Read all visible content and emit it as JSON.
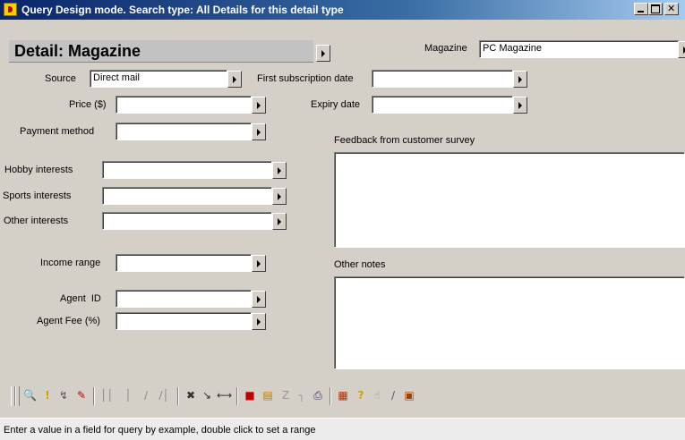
{
  "window": {
    "title": "Query Design mode. Search type: All Details for this detail type"
  },
  "header": {
    "detail_title": "Detail: Magazine"
  },
  "magazine": {
    "label": "Magazine",
    "value": "PC Magazine"
  },
  "fields": {
    "source": {
      "label": "Source",
      "value": "Direct mail"
    },
    "price": {
      "label": "Price ($)",
      "value": ""
    },
    "payment_method": {
      "label": "Payment method",
      "value": ""
    },
    "first_subscription_date": {
      "label": "First subscription date",
      "value": ""
    },
    "expiry_date": {
      "label": "Expiry date",
      "value": ""
    },
    "hobby_interests": {
      "label": "Hobby interests",
      "value": ""
    },
    "sports_interests": {
      "label": "Sports interests",
      "value": ""
    },
    "other_interests": {
      "label": "Other interests",
      "value": ""
    },
    "income_range": {
      "label": "Income range",
      "value": ""
    },
    "agent_id": {
      "label": "Agent  ID",
      "value": ""
    },
    "agent_fee": {
      "label": "Agent Fee (%)",
      "value": ""
    }
  },
  "feedback": {
    "label": "Feedback from customer survey"
  },
  "other_notes": {
    "label": "Other notes"
  },
  "toolbar": {
    "icons": [
      "magnify-icon",
      "exclamation-icon",
      "wand-icon",
      "pencil-icon",
      "bar-icon",
      "line-icon",
      "slash-icon",
      "slash2-icon",
      "cross-icon",
      "arrow-icon",
      "double-arrow-icon",
      "book-icon",
      "clipboard-icon",
      "z-icon",
      "frame-icon",
      "search-doc-icon",
      "chart-icon",
      "help-icon",
      "hand-icon",
      "wand2-icon",
      "exit-icon"
    ]
  },
  "status": {
    "text": "Enter a value in a field for query by example, double click to set a range"
  }
}
